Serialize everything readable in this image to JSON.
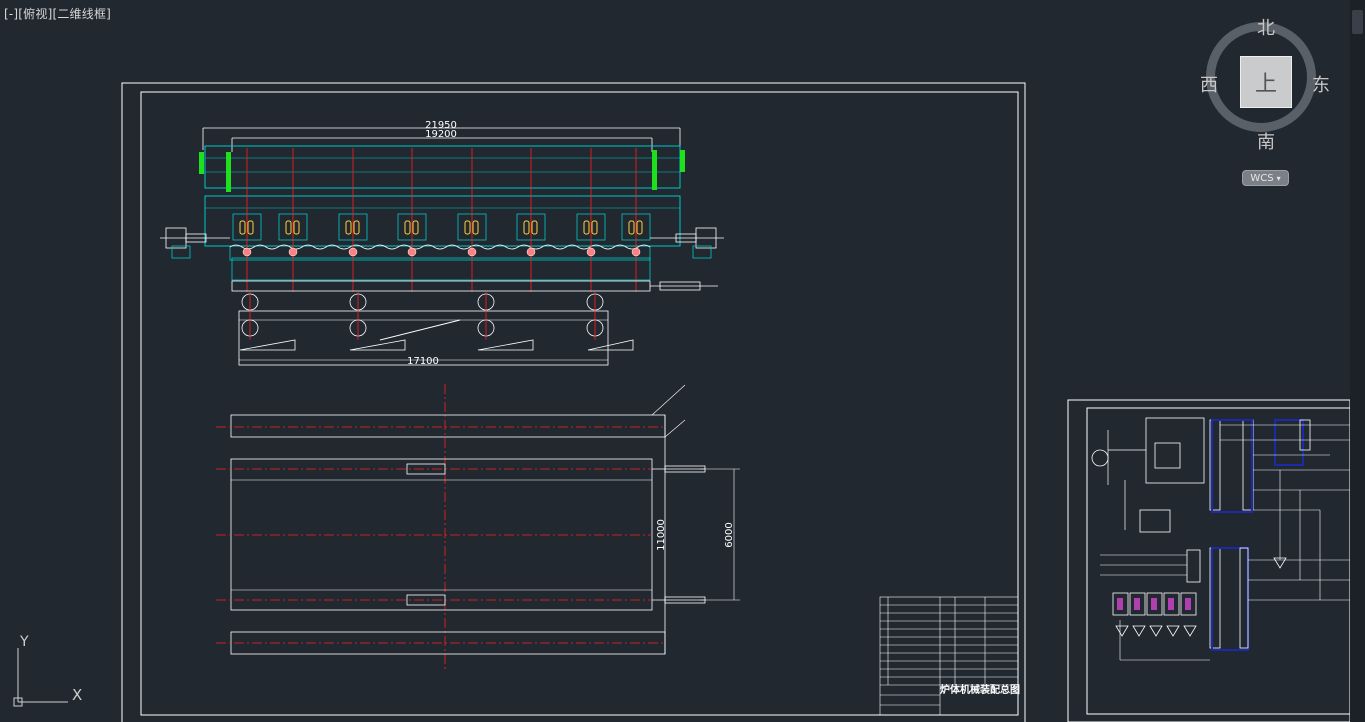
{
  "viewport": {
    "label": "[-][俯视][二维线框]"
  },
  "viewcube": {
    "north": "北",
    "south": "南",
    "east": "东",
    "west": "西",
    "face": "上"
  },
  "wcs": {
    "label": "WCS",
    "arrow": "▾"
  },
  "ucs": {
    "y": "Y",
    "x": "X"
  },
  "drawing": {
    "dim_overall": "21950",
    "dim_inner": "19200",
    "dim_base": "17100",
    "dim_width": "11000",
    "dim_span": "6000",
    "title_block": {
      "title": "炉体机械装配总图"
    }
  },
  "colors": {
    "background": "#212830",
    "cyan": "#00c8c8",
    "red": "#ff2020",
    "white": "#ffffff",
    "yellow": "#ffd23c",
    "green": "#1fe01f",
    "blue": "#1a2aa8"
  }
}
